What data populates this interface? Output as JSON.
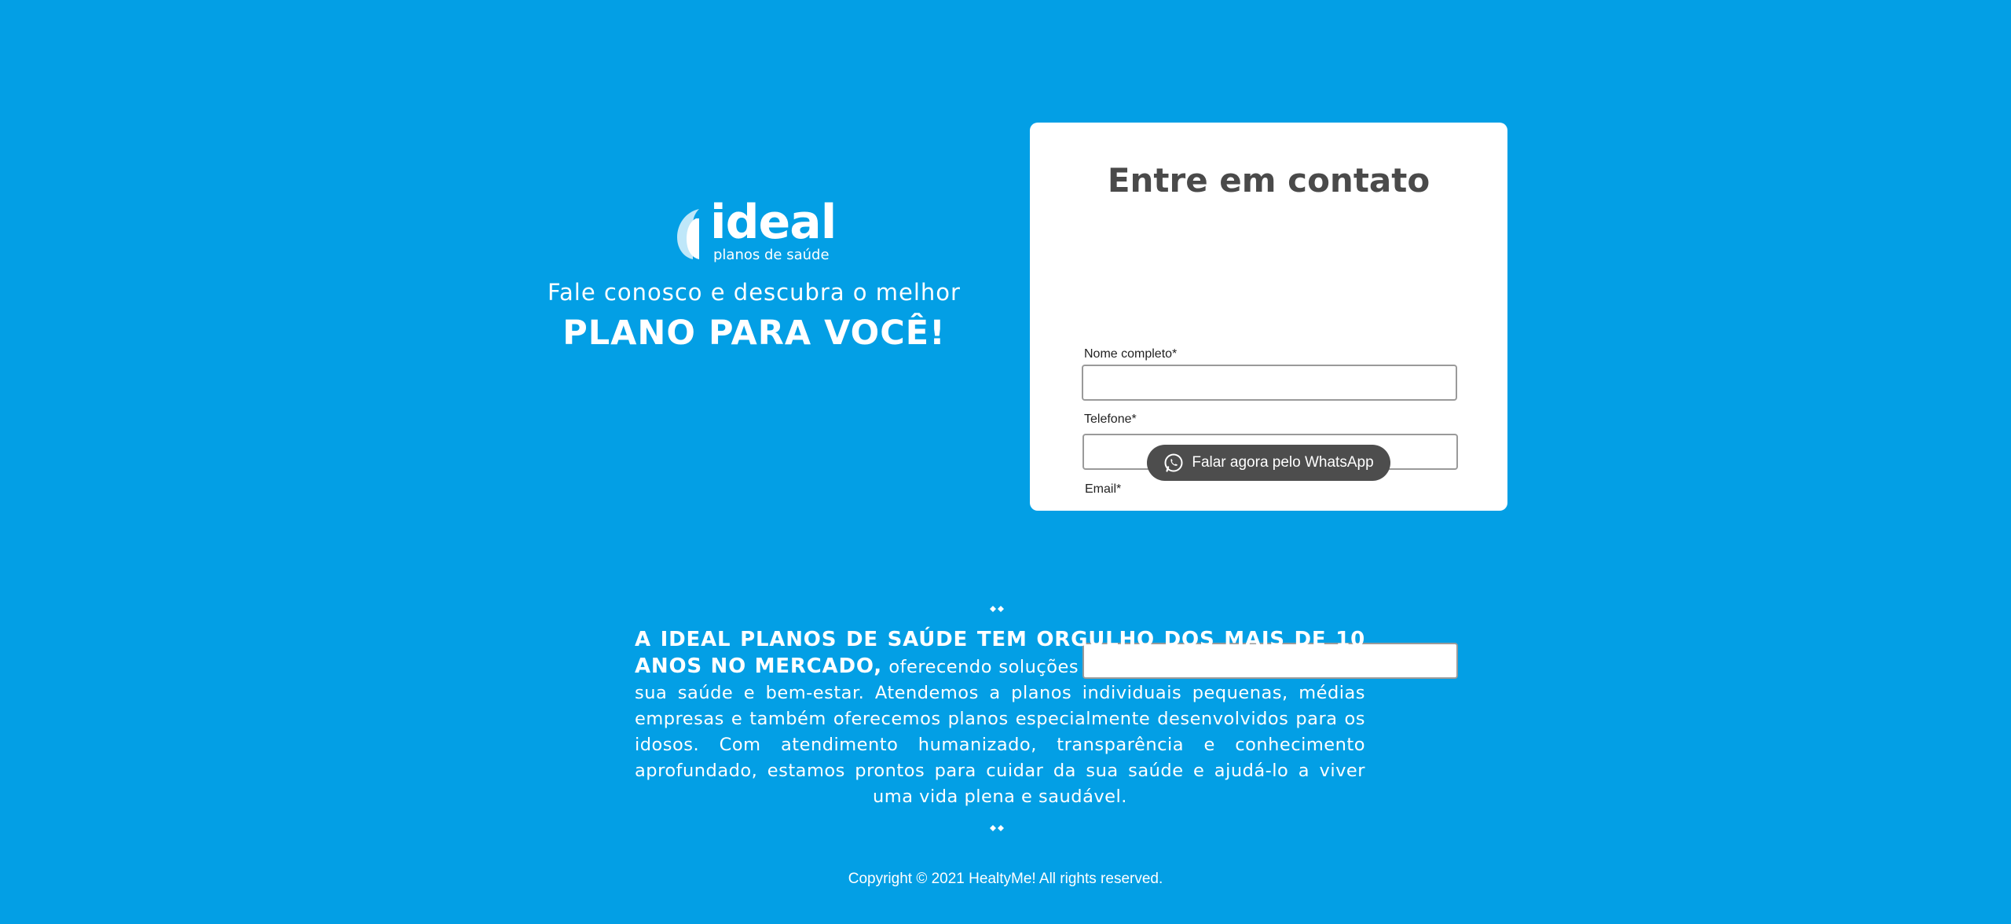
{
  "brand": {
    "name": "ideal",
    "tagline": "planos de saúde",
    "logo_icon": "ideal-logo-mark"
  },
  "hero": {
    "subtitle": "Fale conosco e descubra o melhor",
    "title": "PLANO PARA VOCÊ!"
  },
  "contact_form": {
    "title": "Entre em contato",
    "fields": [
      {
        "label": "Nome completo*",
        "value": "",
        "placeholder": ""
      },
      {
        "label": "Telefone*",
        "value": "",
        "placeholder": ""
      },
      {
        "label": "Email*",
        "value": "",
        "placeholder": ""
      }
    ],
    "submit_label": "Falar agora pelo WhatsApp",
    "submit_icon": "whatsapp-icon"
  },
  "about": {
    "highlight": "A IDEAL PLANOS DE SAÚDE TEM ORGULHO DOS MAIS DE 10 ANOS NO MERCADO,",
    "body": "oferecendo soluções personalizadas para cuidar da sua saúde e bem-estar. Atendemos a planos individuais pequenas, médias empresas e também oferecemos planos especialmente desenvolvidos para os idosos. Com atendimento humanizado, transparência e conhecimento aprofundado, estamos prontos para cuidar da sua saúde e ajudá-lo a viver uma vida plena e saudável."
  },
  "footer": {
    "copyright": "Copyright © 2021 HealtyMe! All rights reserved."
  },
  "colors": {
    "background": "#039fe5",
    "card": "#ffffff",
    "heading": "#4a4a4a",
    "button": "#4d4d4d"
  }
}
